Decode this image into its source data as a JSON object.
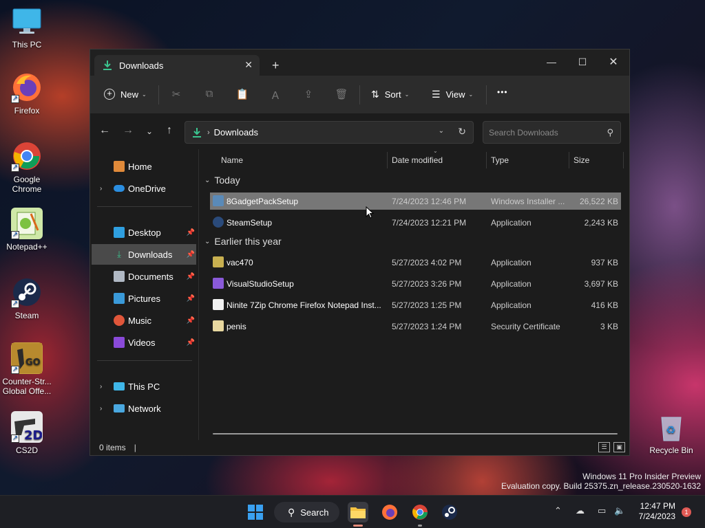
{
  "desktop": {
    "icons": [
      {
        "label": "This PC"
      },
      {
        "label": "Firefox"
      },
      {
        "label": "Google Chrome"
      },
      {
        "label": "Notepad++"
      },
      {
        "label": "Steam"
      },
      {
        "label": "Counter-Str... Global Offe..."
      },
      {
        "label": "CS2D"
      },
      {
        "label": "Recycle Bin"
      }
    ],
    "watermark_line1": "Windows 11 Pro Insider Preview",
    "watermark_line2": "Evaluation copy. Build 25375.zn_release.230520-1632"
  },
  "window": {
    "tab_title": "Downloads",
    "tab_close": "✕",
    "new_tab": "+",
    "minimize": "—",
    "maximize": "☐",
    "close": "✕",
    "toolbar": {
      "new_label": "New",
      "sort_label": "Sort",
      "view_label": "View",
      "more_label": "•••"
    },
    "address": {
      "crumb": "Downloads"
    },
    "search": {
      "placeholder": "Search Downloads"
    },
    "sidebar": {
      "items": [
        {
          "label": "Home"
        },
        {
          "label": "OneDrive"
        },
        {
          "label": "Desktop"
        },
        {
          "label": "Downloads"
        },
        {
          "label": "Documents"
        },
        {
          "label": "Pictures"
        },
        {
          "label": "Music"
        },
        {
          "label": "Videos"
        },
        {
          "label": "This PC"
        },
        {
          "label": "Network"
        }
      ]
    },
    "columns": {
      "name": "Name",
      "date": "Date modified",
      "type": "Type",
      "size": "Size"
    },
    "groups": [
      {
        "label": "Today",
        "files": [
          {
            "name": "8GadgetPackSetup",
            "date": "7/24/2023 12:46 PM",
            "type": "Windows Installer ...",
            "size": "26,522 KB"
          },
          {
            "name": "SteamSetup",
            "date": "7/24/2023 12:21 PM",
            "type": "Application",
            "size": "2,243 KB"
          }
        ]
      },
      {
        "label": "Earlier this year",
        "files": [
          {
            "name": "vac470",
            "date": "5/27/2023 4:02 PM",
            "type": "Application",
            "size": "937 KB"
          },
          {
            "name": "VisualStudioSetup",
            "date": "5/27/2023 3:26 PM",
            "type": "Application",
            "size": "3,697 KB"
          },
          {
            "name": "Ninite 7Zip Chrome Firefox Notepad Inst...",
            "date": "5/27/2023 1:25 PM",
            "type": "Application",
            "size": "416 KB"
          },
          {
            "name": "penis",
            "date": "5/27/2023 1:24 PM",
            "type": "Security Certificate",
            "size": "3 KB"
          }
        ]
      }
    ],
    "status": {
      "items_count": "0 items",
      "separator": "|"
    }
  },
  "taskbar": {
    "search_label": "Search",
    "time": "12:47 PM",
    "date": "7/24/2023",
    "notification_count": "1"
  }
}
